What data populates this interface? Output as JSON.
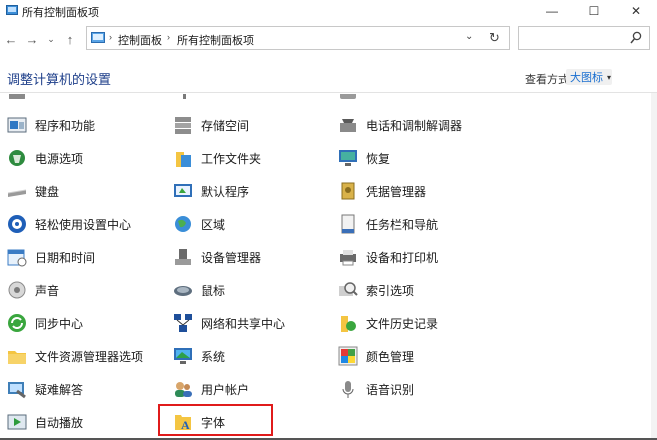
{
  "window": {
    "title": "所有控制面板项",
    "minimize_icon": "minimize-icon",
    "maximize_icon": "maximize-icon",
    "close_icon": "close-icon"
  },
  "nav": {
    "back_icon": "arrow-left-icon",
    "forward_icon": "arrow-right-icon",
    "history_icon": "chevron-down-icon",
    "up_icon": "arrow-up-icon"
  },
  "address": {
    "crumbs": [
      "控制面板",
      "所有控制面板项"
    ],
    "separator": "›",
    "dropdown_glyph": "⌄",
    "refresh_glyph": "↻"
  },
  "search": {
    "placeholder": ""
  },
  "header": {
    "title": "调整计算机的设置",
    "view_by_label": "查看方式:",
    "view_by_value": "大图标",
    "view_by_caret": "▾"
  },
  "items": [
    {
      "label": "程序和功能",
      "icon": "programs-features-icon"
    },
    {
      "label": "存储空间",
      "icon": "storage-spaces-icon"
    },
    {
      "label": "电话和调制解调器",
      "icon": "phone-modem-icon"
    },
    {
      "label": "电源选项",
      "icon": "power-options-icon"
    },
    {
      "label": "工作文件夹",
      "icon": "work-folders-icon"
    },
    {
      "label": "恢复",
      "icon": "recovery-icon"
    },
    {
      "label": "键盘",
      "icon": "keyboard-icon"
    },
    {
      "label": "默认程序",
      "icon": "default-programs-icon"
    },
    {
      "label": "凭据管理器",
      "icon": "credential-manager-icon"
    },
    {
      "label": "轻松使用设置中心",
      "icon": "ease-of-access-icon"
    },
    {
      "label": "区域",
      "icon": "region-globe-icon"
    },
    {
      "label": "任务栏和导航",
      "icon": "taskbar-navigation-icon"
    },
    {
      "label": "日期和时间",
      "icon": "date-time-icon"
    },
    {
      "label": "设备管理器",
      "icon": "device-manager-icon"
    },
    {
      "label": "设备和打印机",
      "icon": "devices-printers-icon"
    },
    {
      "label": "声音",
      "icon": "sound-speaker-icon"
    },
    {
      "label": "鼠标",
      "icon": "mouse-icon"
    },
    {
      "label": "索引选项",
      "icon": "indexing-options-icon"
    },
    {
      "label": "同步中心",
      "icon": "sync-center-icon"
    },
    {
      "label": "网络和共享中心",
      "icon": "network-sharing-icon"
    },
    {
      "label": "文件历史记录",
      "icon": "file-history-icon"
    },
    {
      "label": "文件资源管理器选项",
      "icon": "file-explorer-options-icon"
    },
    {
      "label": "系统",
      "icon": "system-monitor-icon"
    },
    {
      "label": "颜色管理",
      "icon": "color-management-icon"
    },
    {
      "label": "疑难解答",
      "icon": "troubleshooting-icon"
    },
    {
      "label": "用户帐户",
      "icon": "user-accounts-icon"
    },
    {
      "label": "语音识别",
      "icon": "microphone-icon"
    },
    {
      "label": "自动播放",
      "icon": "autoplay-icon"
    },
    {
      "label": "字体",
      "icon": "fonts-icon"
    }
  ],
  "colors": {
    "heading": "#1e3f8a",
    "link_blue": "#1a6fd0",
    "highlight_border": "#e01b1b"
  }
}
